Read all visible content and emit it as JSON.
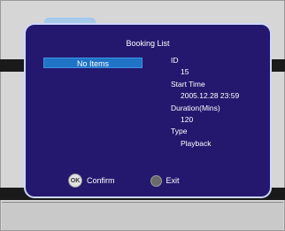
{
  "dialog": {
    "title": "Booking List",
    "list_item": "No Items"
  },
  "info": {
    "id_label": "ID",
    "id_value": "15",
    "start_label": "Start Time",
    "start_value": "2005.12.28 23:59",
    "duration_label": "Duration(Mins)",
    "duration_value": "120",
    "type_label": "Type",
    "type_value": "Playback"
  },
  "footer": {
    "ok_glyph": "OK",
    "confirm_label": "Confirm",
    "exit_label": "Exit"
  },
  "colors": {
    "dialog_bg": "#23186e",
    "selection": "#1f74c6"
  }
}
